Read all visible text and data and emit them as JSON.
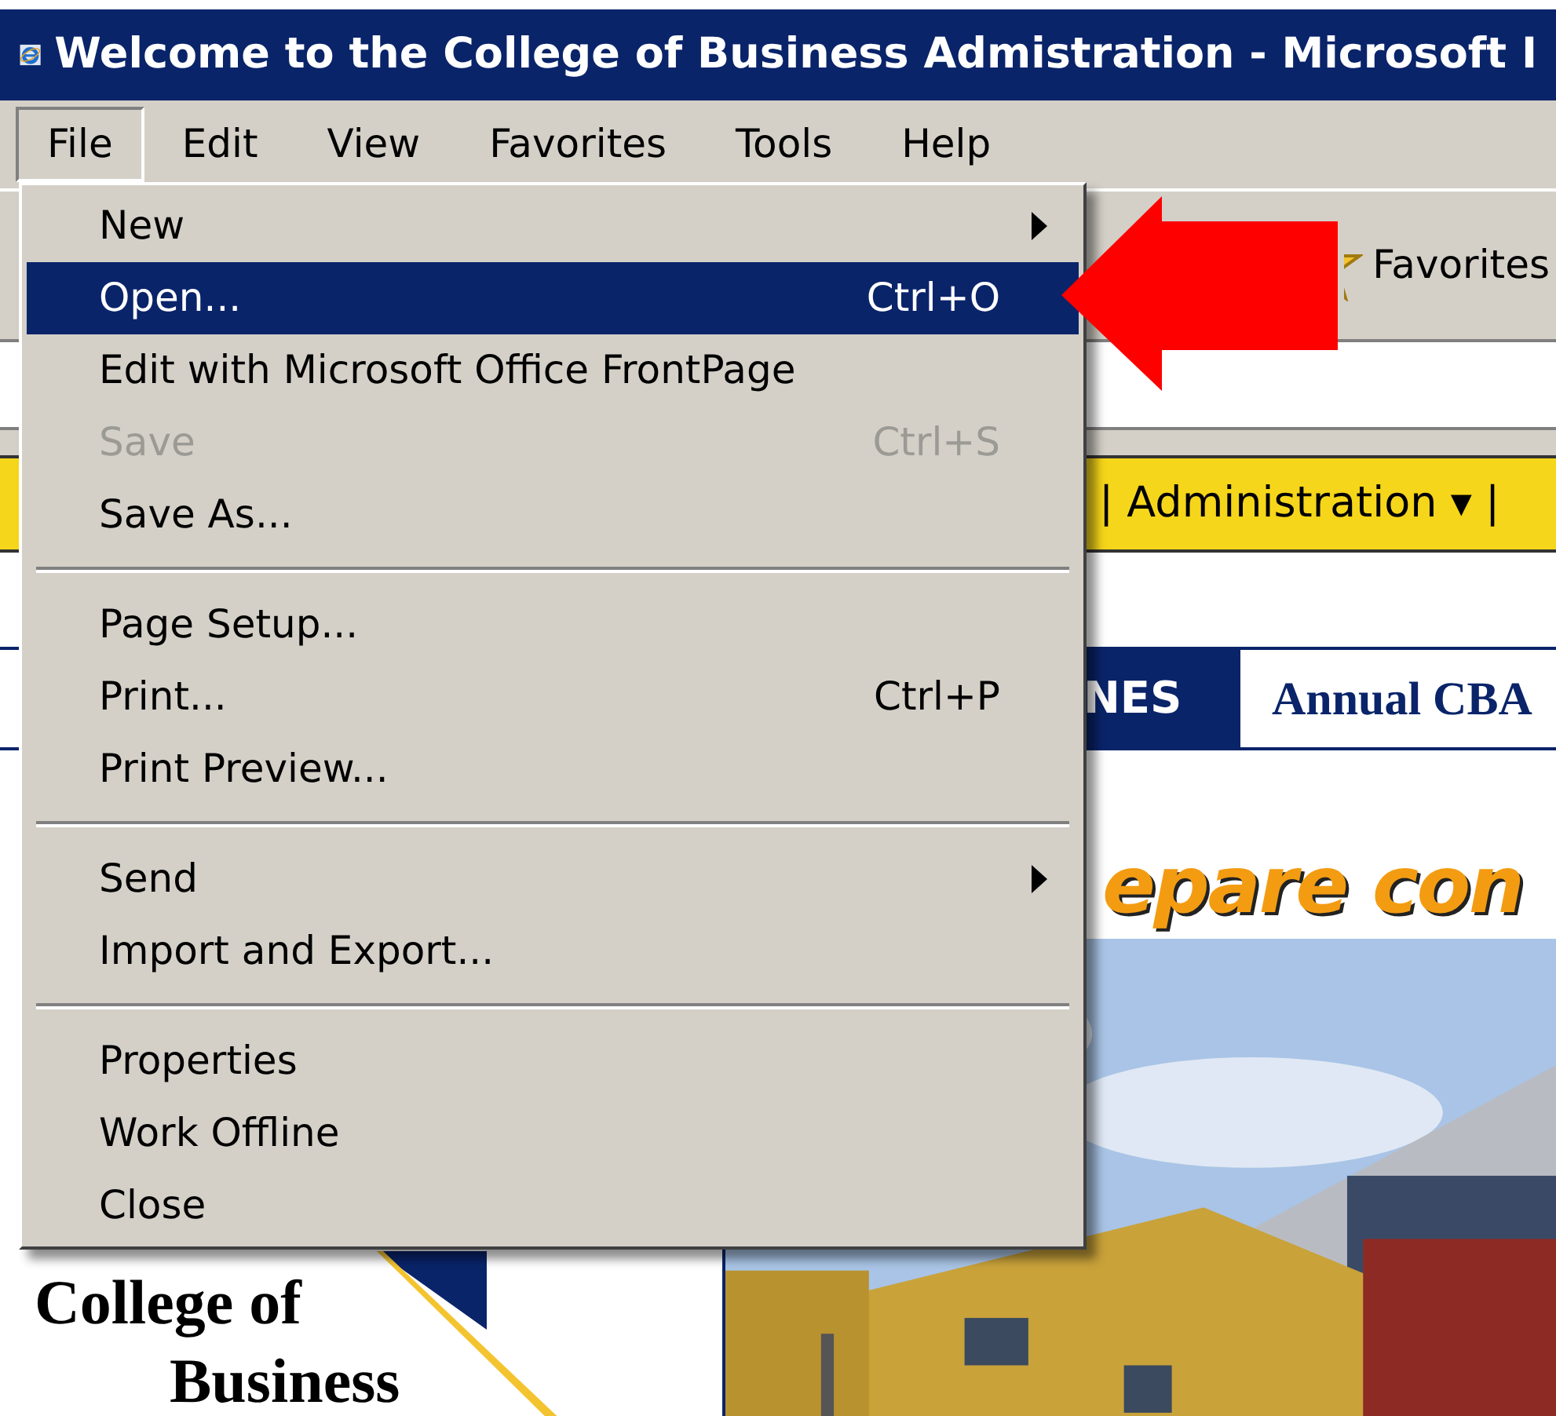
{
  "window": {
    "title": "Welcome to the College of Business Admistration - Microsoft I"
  },
  "menu_bar": [
    {
      "label": "File",
      "selected": true
    },
    {
      "label": "Edit",
      "selected": false
    },
    {
      "label": "View",
      "selected": false
    },
    {
      "label": "Favorites",
      "selected": false
    },
    {
      "label": "Tools",
      "selected": false
    },
    {
      "label": "Help",
      "selected": false
    }
  ],
  "toolbar": {
    "favorites_button": "Favorites"
  },
  "page": {
    "nav_link": "| Administration ▾ |",
    "banner_tab": "NES",
    "banner_title": "Annual CBA",
    "headline": "epare con",
    "logo_lines": [
      "College of",
      "Business"
    ]
  },
  "file_menu": [
    {
      "kind": "item",
      "label": "New",
      "submenu": true,
      "disabled": false,
      "selected": false
    },
    {
      "kind": "item",
      "label": "Open...",
      "shortcut": "Ctrl+O",
      "disabled": false,
      "selected": true
    },
    {
      "kind": "item",
      "label": "Edit with Microsoft Office FrontPage",
      "disabled": false,
      "selected": false
    },
    {
      "kind": "item",
      "label": "Save",
      "shortcut": "Ctrl+S",
      "disabled": true,
      "selected": false
    },
    {
      "kind": "item",
      "label": "Save As...",
      "disabled": false,
      "selected": false
    },
    {
      "kind": "separator"
    },
    {
      "kind": "item",
      "label": "Page Setup...",
      "disabled": false,
      "selected": false
    },
    {
      "kind": "item",
      "label": "Print...",
      "shortcut": "Ctrl+P",
      "disabled": false,
      "selected": false
    },
    {
      "kind": "item",
      "label": "Print Preview...",
      "disabled": false,
      "selected": false
    },
    {
      "kind": "separator"
    },
    {
      "kind": "item",
      "label": "Send",
      "submenu": true,
      "disabled": false,
      "selected": false
    },
    {
      "kind": "item",
      "label": "Import and Export...",
      "disabled": false,
      "selected": false
    },
    {
      "kind": "separator"
    },
    {
      "kind": "item",
      "label": "Properties",
      "disabled": false,
      "selected": false
    },
    {
      "kind": "item",
      "label": "Work Offline",
      "disabled": false,
      "selected": false
    },
    {
      "kind": "item",
      "label": "Close",
      "disabled": false,
      "selected": false
    }
  ]
}
